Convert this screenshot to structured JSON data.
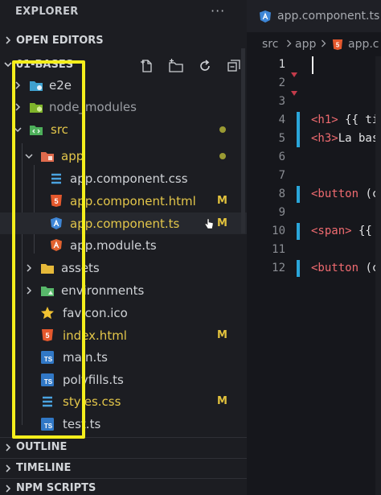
{
  "explorer": {
    "title": "EXPLORER",
    "more_label": "···",
    "open_editors": "OPEN EDITORS",
    "workspace": "01-BASES",
    "outline": "OUTLINE",
    "timeline": "TIMELINE",
    "npm_scripts": "NPM SCRIPTS"
  },
  "tree": [
    {
      "label": "e2e",
      "icon": "folder-e2e-icon",
      "expanded": false,
      "status": ""
    },
    {
      "label": "node_modules",
      "icon": "folder-node-icon",
      "expanded": false,
      "status": ""
    },
    {
      "label": "src",
      "icon": "folder-src-icon",
      "expanded": true,
      "status": "dot"
    },
    {
      "label": "app",
      "icon": "folder-app-icon",
      "expanded": true,
      "status": "dot"
    },
    {
      "label": "app.component.css",
      "icon": "css-icon",
      "status": ""
    },
    {
      "label": "app.component.html",
      "icon": "html5-icon",
      "status": "M"
    },
    {
      "label": "app.component.ts",
      "icon": "angular-icon",
      "status": "M"
    },
    {
      "label": "app.module.ts",
      "icon": "angular-icon",
      "status": ""
    },
    {
      "label": "assets",
      "icon": "folder-assets-icon",
      "expanded": false,
      "status": ""
    },
    {
      "label": "environments",
      "icon": "folder-env-icon",
      "expanded": false,
      "status": ""
    },
    {
      "label": "favicon.ico",
      "icon": "star-icon",
      "status": ""
    },
    {
      "label": "index.html",
      "icon": "html5-icon",
      "status": "M"
    },
    {
      "label": "main.ts",
      "icon": "typescript-icon",
      "status": ""
    },
    {
      "label": "polyfills.ts",
      "icon": "typescript-icon",
      "status": ""
    },
    {
      "label": "styles.css",
      "icon": "css-icon",
      "status": "M"
    },
    {
      "label": "test.ts",
      "icon": "typescript-icon",
      "status": ""
    }
  ],
  "editor": {
    "tab_label": "app.component.ts",
    "breadcrumb": [
      "src",
      "app",
      "app.c"
    ],
    "line_numbers": [
      "1",
      "2",
      "3",
      "4",
      "5",
      "6",
      "7",
      "8",
      "9",
      "10",
      "11",
      "12"
    ],
    "code": {
      "l4_tag": "<h1>",
      "l4_rest": " {{ ti",
      "l5_tag": "<h3>",
      "l5_rest": "La bas",
      "l8_tag": "<button",
      "l8_rest": " (c",
      "l10_tag": "<span>",
      "l10_rest": " {{",
      "l12_tag": "<button",
      "l12_rest": " (c"
    }
  },
  "colors": {
    "modified": "#e3c64a",
    "highlight_box": "#f4ee1c",
    "git_added": "#2aa6da"
  }
}
